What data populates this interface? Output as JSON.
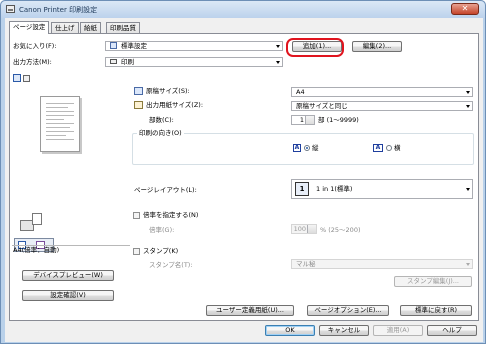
{
  "window": {
    "title": "Canon Printer 印刷設定",
    "close_label": "✕"
  },
  "tabs": [
    "ページ設定",
    "仕上げ",
    "給紙",
    "印刷品質"
  ],
  "favorites": {
    "label": "お気に入り(F):",
    "value": "標準設定",
    "add_label": "追加(1)...",
    "edit_label": "編集(2)..."
  },
  "output": {
    "label": "出力方法(M):",
    "value": "印刷"
  },
  "paper": {
    "original_label": "原稿サイズ(S):",
    "original_value": "A4",
    "output_label": "出力用紙サイズ(Z):",
    "output_value": "原稿サイズと同じ",
    "copies_label": "部数(C):",
    "copies_value": "1",
    "copies_unit": "部 (1〜9999)"
  },
  "orientation": {
    "label": "印刷の向き(O)",
    "portrait": "縦",
    "landscape": "横",
    "portrait_icon": "A",
    "landscape_icon": "A"
  },
  "layout": {
    "label": "ページレイアウト(L):",
    "icon_text": "1",
    "value": "1 in 1(標準)"
  },
  "scale": {
    "label": "倍率を指定する(N)",
    "sub_label": "倍率(G):",
    "value": "100",
    "unit": "% (25〜200)"
  },
  "stamp": {
    "label": "スタンプ(K)",
    "sub_label": "スタンプ名(T):",
    "value": "マル秘",
    "edit_label": "スタンプ編集(J)..."
  },
  "preview": {
    "status": "A4(倍率：自動)",
    "device_preview_label": "デバイスプレビュー(W)",
    "settings_check_label": "設定確認(V)"
  },
  "panel_buttons": {
    "user_paper": "ユーザー定義用紙(U)...",
    "page_options": "ページオプション(E)...",
    "restore": "標準に戻す(R)"
  },
  "footer": {
    "ok": "OK",
    "cancel": "キャンセル",
    "apply": "適用(A)",
    "help": "ヘルプ"
  }
}
